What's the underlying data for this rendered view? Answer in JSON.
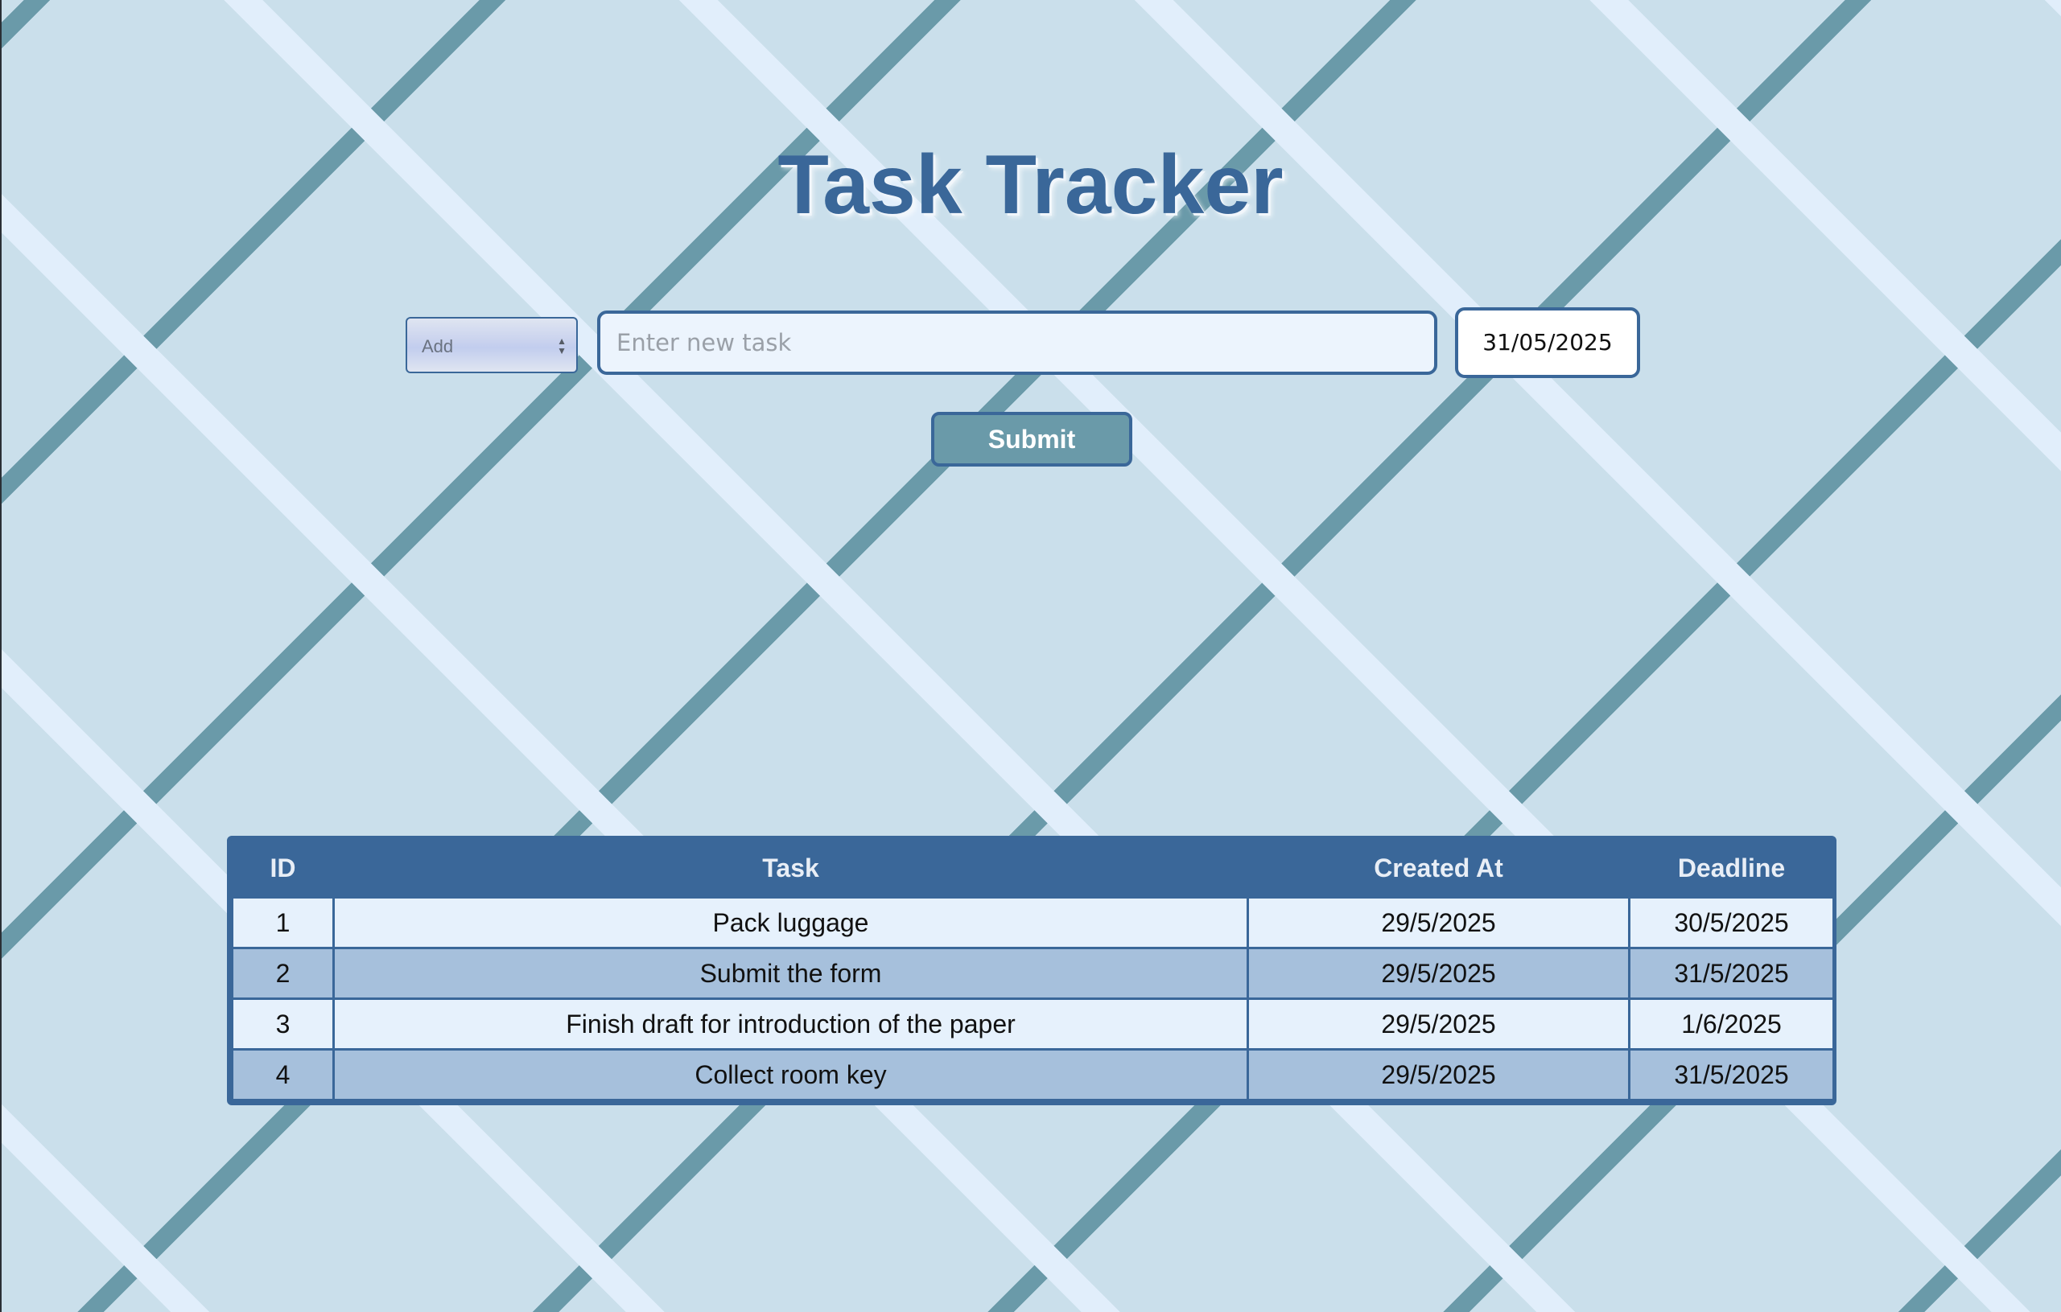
{
  "page": {
    "title": "Task Tracker"
  },
  "form": {
    "action_select": {
      "value": "Add",
      "options": [
        "Add"
      ]
    },
    "task_input": {
      "value": "",
      "placeholder": "Enter new task"
    },
    "deadline_date": "31/05/2025",
    "submit_label": "Submit"
  },
  "table": {
    "headers": {
      "id": "ID",
      "task": "Task",
      "created_at": "Created At",
      "deadline": "Deadline"
    },
    "rows": [
      {
        "id": "1",
        "task": "Pack luggage",
        "created_at": "29/5/2025",
        "deadline": "30/5/2025"
      },
      {
        "id": "2",
        "task": "Submit the form",
        "created_at": "29/5/2025",
        "deadline": "31/5/2025"
      },
      {
        "id": "3",
        "task": "Finish draft for introduction of the paper",
        "created_at": "29/5/2025",
        "deadline": "1/6/2025"
      },
      {
        "id": "4",
        "task": "Collect room key",
        "created_at": "29/5/2025",
        "deadline": "31/5/2025"
      }
    ]
  },
  "colors": {
    "primary": "#3a6799",
    "background": "#cadfeb",
    "accent_teal": "#6a9aa9",
    "row_light": "#e6f1fc",
    "row_dark": "#a6c0dc"
  },
  "icons": {
    "select_arrows": "updown-chevron-icon"
  }
}
